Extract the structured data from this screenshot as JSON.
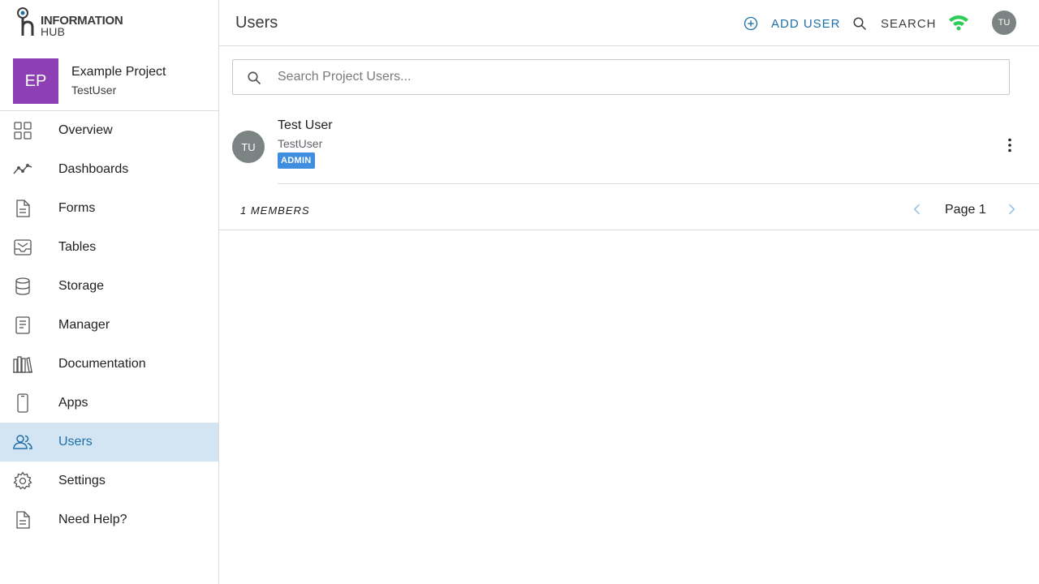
{
  "logo": {
    "line1": "INFORMATION",
    "line2": "HUB"
  },
  "project": {
    "initials": "EP",
    "name": "Example Project",
    "user": "TestUser",
    "color": "#8e3fb3"
  },
  "sidebar": {
    "items": [
      {
        "label": "Overview",
        "icon": "grid-icon"
      },
      {
        "label": "Dashboards",
        "icon": "trend-line-icon"
      },
      {
        "label": "Forms",
        "icon": "document-icon"
      },
      {
        "label": "Tables",
        "icon": "inbox-tray-icon"
      },
      {
        "label": "Storage",
        "icon": "database-icon"
      },
      {
        "label": "Manager",
        "icon": "clipboard-icon"
      },
      {
        "label": "Documentation",
        "icon": "books-icon"
      },
      {
        "label": "Apps",
        "icon": "mobile-phone-icon"
      },
      {
        "label": "Users",
        "icon": "users-icon",
        "active": true
      },
      {
        "label": "Settings",
        "icon": "gear-icon"
      },
      {
        "label": "Need Help?",
        "icon": "help-document-icon"
      }
    ],
    "active_color": "#d3e5f2"
  },
  "header": {
    "title": "Users",
    "add_user_label": "ADD USER",
    "search_label": "SEARCH",
    "avatar_initials": "TU",
    "accent_color": "#1e6fa8",
    "wifi_color": "#2ecc5a"
  },
  "search": {
    "placeholder": "Search Project Users...",
    "value": ""
  },
  "users": [
    {
      "initials": "TU",
      "name": "Test User",
      "handle": "TestUser",
      "role": "ADMIN"
    }
  ],
  "footer": {
    "members_label": "1 MEMBERS",
    "page_label": "Page 1"
  }
}
